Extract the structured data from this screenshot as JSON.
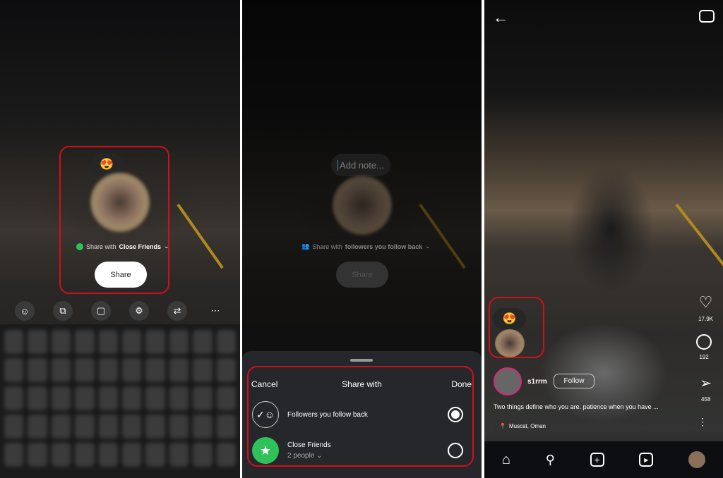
{
  "panel1": {
    "note_emoji": "😍",
    "share_with_prefix": "Share with ",
    "share_with_target": "Close Friends",
    "share_button": "Share",
    "toolbar": [
      {
        "icon": "emoji-icon",
        "glyph": "☺"
      },
      {
        "icon": "text-translate-icon",
        "glyph": "⧉"
      },
      {
        "icon": "clipboard-icon",
        "glyph": "▢"
      },
      {
        "icon": "gear-icon",
        "glyph": "⚙"
      },
      {
        "icon": "translate-icon",
        "glyph": "⇄"
      },
      {
        "icon": "more-icon",
        "glyph": "⋯"
      }
    ]
  },
  "panel2": {
    "note_placeholder": "Add note...",
    "share_with_prefix": "Share with ",
    "share_with_target": "followers you follow back",
    "share_button": "Share",
    "sheet": {
      "cancel": "Cancel",
      "title": "Share with",
      "done": "Done",
      "options": [
        {
          "label": "Followers you follow back",
          "selected": true
        },
        {
          "label": "Close Friends",
          "sub": "2 people",
          "selected": false
        }
      ]
    },
    "colors": {
      "close_friends": "#2fc25b"
    }
  },
  "panel3": {
    "note_emoji": "😍",
    "username": "s1rrm",
    "follow": "Follow",
    "caption": "Two things define who you are. patience when you have ...",
    "location": "Muscat, Oman",
    "likes": "17.9K",
    "comments": "192",
    "shares": "458",
    "nav": [
      "home-icon",
      "search-icon",
      "create-icon",
      "reels-icon",
      "profile-avatar"
    ]
  },
  "colors": {
    "highlight": "#d0101a"
  }
}
